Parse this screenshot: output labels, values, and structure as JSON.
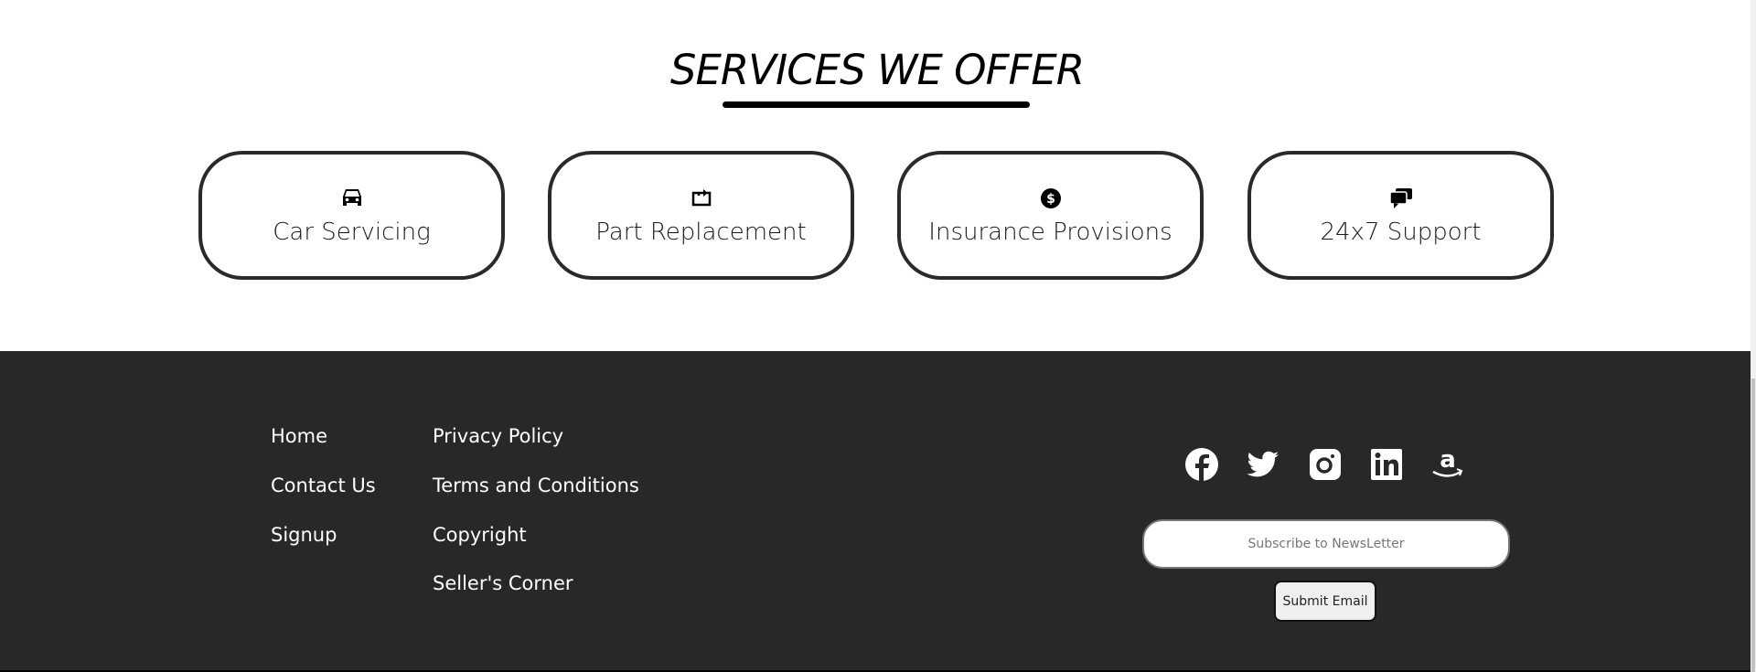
{
  "services": {
    "title": "SERVICES WE OFFER",
    "items": [
      {
        "label": "Car Servicing",
        "icon": "car-icon"
      },
      {
        "label": "Part Replacement",
        "icon": "replace-icon"
      },
      {
        "label": "Insurance Provisions",
        "icon": "dollar-circle-icon"
      },
      {
        "label": "24x7 Support",
        "icon": "chat-bubbles-icon"
      }
    ]
  },
  "footer": {
    "links_col1": [
      "Home",
      "Contact Us",
      "Signup"
    ],
    "links_col2": [
      "Privacy Policy",
      "Terms and Conditions",
      "Copyright",
      "Seller's Corner"
    ],
    "social": [
      "facebook-icon",
      "twitter-icon",
      "instagram-icon",
      "linkedin-icon",
      "amazon-icon"
    ],
    "newsletter_placeholder": "Subscribe to NewsLetter",
    "submit_label": "Submit Email"
  }
}
